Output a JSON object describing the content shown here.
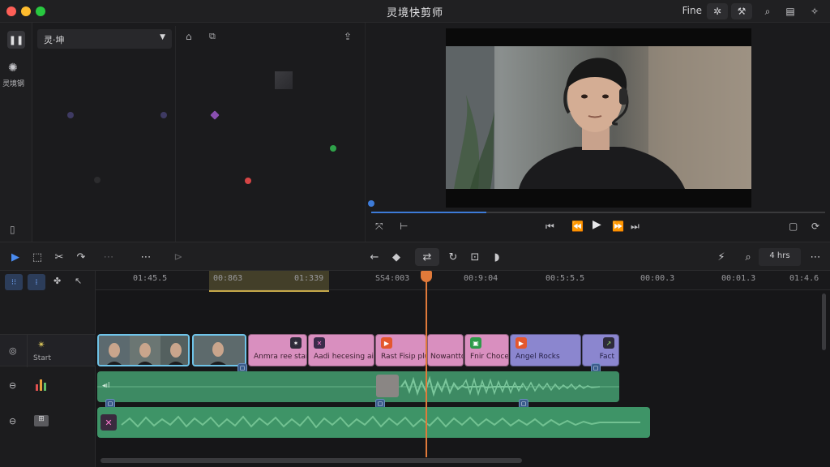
{
  "window": {
    "title": "灵境快剪师",
    "plan_label": "Fine"
  },
  "media": {
    "dropdown_value": "灵·坤",
    "left_rail_label": "灵境钢"
  },
  "timeline": {
    "zoom_value": "4 hrs",
    "ruler_ticks": [
      "01:45.5",
      "00:863",
      "01:339",
      "SS4:003",
      "00:9:04",
      "00:5:5.5",
      "00:00.3",
      "00:01.3",
      "01:4.6"
    ],
    "track_labels": {
      "video": "Start"
    },
    "video_clips": [
      {
        "label": "Anmra    ree start",
        "badge": "✶"
      },
      {
        "label": "Aadi hecesing aint",
        "badge": "✕"
      },
      {
        "label": "Rast  Fisip  plus",
        "badge": "▶"
      },
      {
        "label": "Nowantto",
        "badge": ""
      },
      {
        "label": "Fnir  Choce",
        "badge": "▣"
      },
      {
        "label": "Angel  Rocks",
        "badge": "▶"
      },
      {
        "label": "Fact",
        "badge": "↗"
      }
    ]
  },
  "colors": {
    "accent_blue": "#3d7bd8",
    "playhead": "#e07a3a",
    "clip_pink": "#d98fbf",
    "clip_purple": "#8b86cf",
    "audio_green": "#3d8a63"
  }
}
